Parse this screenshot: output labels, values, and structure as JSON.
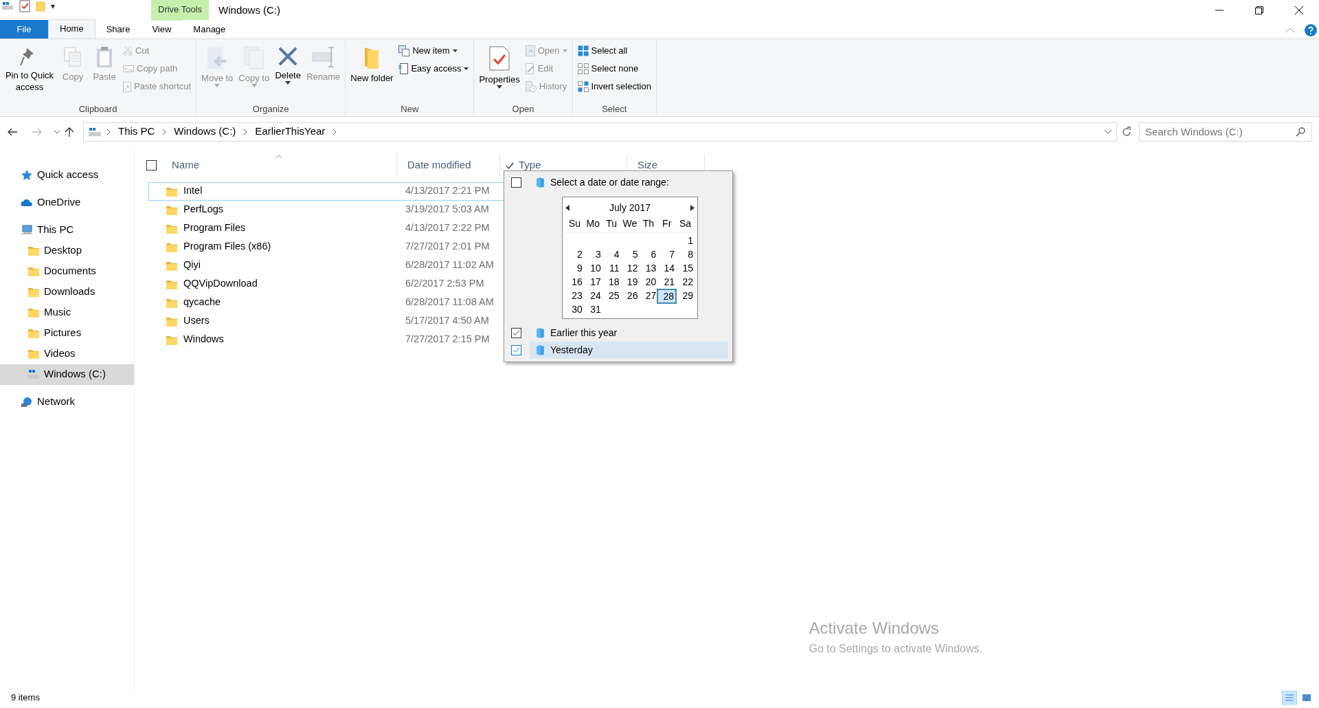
{
  "window": {
    "title": "Windows (C:)",
    "context_tab_group": "Drive Tools"
  },
  "quick_access_toolbar": {
    "dropdown": "▾"
  },
  "tabs": [
    {
      "label": "File",
      "kind": "file",
      "selected": false
    },
    {
      "label": "Home",
      "kind": "tab",
      "selected": true
    },
    {
      "label": "Share",
      "kind": "tab",
      "selected": false
    },
    {
      "label": "View",
      "kind": "tab",
      "selected": false
    },
    {
      "label": "Manage",
      "kind": "context",
      "selected": false
    }
  ],
  "ribbon_groups": [
    {
      "label": "Clipboard",
      "items": [
        {
          "label": "Pin to Quick access",
          "kind": "large",
          "disabled": false,
          "dropdown": false
        },
        {
          "label": "Copy",
          "kind": "large",
          "disabled": true,
          "dropdown": false
        },
        {
          "label": "Paste",
          "kind": "large",
          "disabled": true,
          "dropdown": false
        },
        {
          "label": "Cut",
          "kind": "small",
          "disabled": true,
          "dropdown": false
        },
        {
          "label": "Copy path",
          "kind": "small",
          "disabled": true,
          "dropdown": false
        },
        {
          "label": "Paste shortcut",
          "kind": "small",
          "disabled": true,
          "dropdown": false
        }
      ]
    },
    {
      "label": "Organize",
      "items": [
        {
          "label": "Move to",
          "kind": "large",
          "disabled": true,
          "dropdown": true
        },
        {
          "label": "Copy to",
          "kind": "large",
          "disabled": true,
          "dropdown": true
        },
        {
          "label": "Delete",
          "kind": "large",
          "disabled": false,
          "dropdown": true
        },
        {
          "label": "Rename",
          "kind": "large",
          "disabled": true,
          "dropdown": false
        }
      ]
    },
    {
      "label": "New",
      "items": [
        {
          "label": "New folder",
          "kind": "large",
          "disabled": false,
          "dropdown": false
        },
        {
          "label": "New item",
          "kind": "small",
          "disabled": false,
          "dropdown": true
        },
        {
          "label": "Easy access",
          "kind": "small",
          "disabled": false,
          "dropdown": true
        }
      ]
    },
    {
      "label": "Open",
      "items": [
        {
          "label": "Properties",
          "kind": "large",
          "disabled": false,
          "dropdown": true
        },
        {
          "label": "Open",
          "kind": "small",
          "disabled": true,
          "dropdown": true
        },
        {
          "label": "Edit",
          "kind": "small",
          "disabled": true,
          "dropdown": false
        },
        {
          "label": "History",
          "kind": "small",
          "disabled": true,
          "dropdown": false
        }
      ]
    },
    {
      "label": "Select",
      "items": [
        {
          "label": "Select all",
          "kind": "small",
          "disabled": false,
          "dropdown": false
        },
        {
          "label": "Select none",
          "kind": "small",
          "disabled": false,
          "dropdown": false
        },
        {
          "label": "Invert selection",
          "kind": "small",
          "disabled": false,
          "dropdown": false
        }
      ]
    }
  ],
  "breadcrumb": [
    "This PC",
    "Windows (C:)",
    "EarlierThisYear"
  ],
  "search": {
    "placeholder": "Search Windows (C:)"
  },
  "navigation": [
    {
      "label": "Quick access",
      "selected": false
    },
    {
      "label": "OneDrive",
      "selected": false
    },
    {
      "label": "This PC",
      "selected": false,
      "children": [
        {
          "label": "Desktop",
          "selected": false
        },
        {
          "label": "Documents",
          "selected": false
        },
        {
          "label": "Downloads",
          "selected": false
        },
        {
          "label": "Music",
          "selected": false
        },
        {
          "label": "Pictures",
          "selected": false
        },
        {
          "label": "Videos",
          "selected": false
        },
        {
          "label": "Windows (C:)",
          "selected": true
        }
      ]
    },
    {
      "label": "Network",
      "selected": false
    }
  ],
  "table": {
    "select_all": {
      "checked": false
    },
    "columns": [
      {
        "label": "Name",
        "sorted": true,
        "filtered": false
      },
      {
        "label": "Date modified",
        "sorted": false,
        "filtered": false
      },
      {
        "label": "Type",
        "sorted": false,
        "filtered": true
      },
      {
        "label": "Size",
        "sorted": false,
        "filtered": false
      }
    ],
    "rows": [
      {
        "name": "Intel",
        "date": "4/13/2017 2:21 PM",
        "selected": true
      },
      {
        "name": "PerfLogs",
        "date": "3/19/2017 5:03 AM",
        "selected": false
      },
      {
        "name": "Program Files",
        "date": "4/13/2017 2:22 PM",
        "selected": false
      },
      {
        "name": "Program Files (x86)",
        "date": "7/27/2017 2:01 PM",
        "selected": false
      },
      {
        "name": "Qiyi",
        "date": "6/28/2017 11:02 AM",
        "selected": false
      },
      {
        "name": "QQVipDownload",
        "date": "6/2/2017 2:53 PM",
        "selected": false
      },
      {
        "name": "qycache",
        "date": "6/28/2017 11:08 AM",
        "selected": false
      },
      {
        "name": "Users",
        "date": "5/17/2017 4:50 AM",
        "selected": false
      },
      {
        "name": "Windows",
        "date": "7/27/2017 2:15 PM",
        "selected": false
      }
    ]
  },
  "filter_popup": {
    "items": [
      {
        "label": "Select a date or date range:",
        "checked": false,
        "selected": false,
        "kind": "range"
      },
      {
        "label": "Earlier this year",
        "checked": true,
        "selected": false,
        "kind": "option"
      },
      {
        "label": "Yesterday",
        "checked": true,
        "selected": true,
        "kind": "option"
      }
    ],
    "calendar": {
      "month": "July 2017",
      "weekdays": [
        "Su",
        "Mo",
        "Tu",
        "We",
        "Th",
        "Fr",
        "Sa"
      ],
      "weeks": [
        [
          {
            "d": "1",
            "selected": false
          }
        ],
        [
          {
            "d": "2",
            "selected": false
          },
          {
            "d": "3",
            "selected": false
          },
          {
            "d": "4",
            "selected": false
          },
          {
            "d": "5",
            "selected": false
          },
          {
            "d": "6",
            "selected": false
          },
          {
            "d": "7",
            "selected": false
          },
          {
            "d": "8",
            "selected": false
          }
        ],
        [
          {
            "d": "9",
            "selected": false
          },
          {
            "d": "10",
            "selected": false
          },
          {
            "d": "11",
            "selected": false
          },
          {
            "d": "12",
            "selected": false
          },
          {
            "d": "13",
            "selected": false
          },
          {
            "d": "14",
            "selected": false
          },
          {
            "d": "15",
            "selected": false
          }
        ],
        [
          {
            "d": "16",
            "selected": false
          },
          {
            "d": "17",
            "selected": false
          },
          {
            "d": "18",
            "selected": false
          },
          {
            "d": "19",
            "selected": false
          },
          {
            "d": "20",
            "selected": false
          },
          {
            "d": "21",
            "selected": false
          },
          {
            "d": "22",
            "selected": false
          }
        ],
        [
          {
            "d": "23",
            "selected": false
          },
          {
            "d": "24",
            "selected": false
          },
          {
            "d": "25",
            "selected": false
          },
          {
            "d": "26",
            "selected": false
          },
          {
            "d": "27",
            "selected": false
          },
          {
            "d": "28",
            "selected": true
          },
          {
            "d": "29",
            "selected": false
          }
        ],
        [
          {
            "d": "30",
            "selected": false
          },
          {
            "d": "31",
            "selected": false
          }
        ]
      ]
    }
  },
  "status_bar": {
    "item_count": "9 items",
    "views": [
      {
        "selected": true
      },
      {
        "selected": false
      }
    ]
  },
  "activation_notice": {
    "title": "Activate Windows",
    "text": "Go to Settings to activate Windows."
  }
}
